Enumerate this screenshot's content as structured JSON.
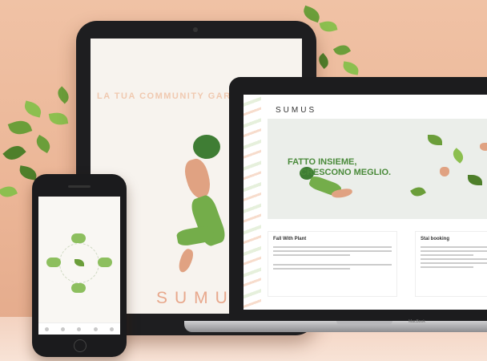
{
  "tablet": {
    "headline": "LA TUA COMMUNITY GARDEN",
    "brand": "SUMUS"
  },
  "laptop": {
    "logo": "SUMUS",
    "headline_line1": "FATTO INSIEME,",
    "headline_line2": "CRESCONO MEGLIO.",
    "card1_title": "Fall With Plant",
    "card2_title": "Stai booking",
    "brand": "MacBook"
  },
  "colors": {
    "background": "#ebb596",
    "accent_green": "#6b9e3a",
    "accent_peach": "#e8a88c"
  }
}
